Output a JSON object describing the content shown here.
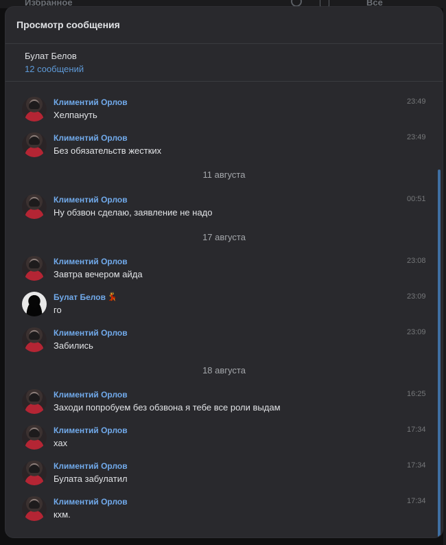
{
  "background": {
    "left_title": "Избранное",
    "right_title": "Все"
  },
  "modal": {
    "title": "Просмотр сообщения",
    "conversation_name": "Булат Белов",
    "message_count": "12 сообщений"
  },
  "colors": {
    "accent": "#71aaeb",
    "link": "#5e9ad8",
    "panel": "#29292d",
    "text": "#e1e3e6"
  },
  "messages": [
    {
      "sender": "Климентий Орлов",
      "text": "Хелпануть",
      "time": "23:49"
    },
    {
      "sender": "Климентий Орлов",
      "text": "Без обязательств жестких",
      "time": "23:49"
    },
    {
      "date": "11 августа"
    },
    {
      "sender": "Климентий Орлов",
      "text": "Ну обзвон сделаю, заявление не надо",
      "time": "00:51"
    },
    {
      "date": "17 августа"
    },
    {
      "sender": "Климентий Орлов",
      "text": "Завтра вечером айда",
      "time": "23:08"
    },
    {
      "sender": "Булат Белов",
      "emoji": "💃",
      "text": "го",
      "time": "23:09"
    },
    {
      "sender": "Климентий Орлов",
      "text": "Забились",
      "time": "23:09"
    },
    {
      "date": "18 августа"
    },
    {
      "sender": "Климентий Орлов",
      "text": "Заходи попробуем без обзвона я тебе все роли выдам",
      "time": "16:25"
    },
    {
      "sender": "Климентий Орлов",
      "text": "хах",
      "time": "17:34"
    },
    {
      "sender": "Климентий Орлов",
      "text": "Булата забулатил",
      "time": "17:34"
    },
    {
      "sender": "Климентий Орлов",
      "text": "кхм.",
      "time": "17:34"
    }
  ]
}
